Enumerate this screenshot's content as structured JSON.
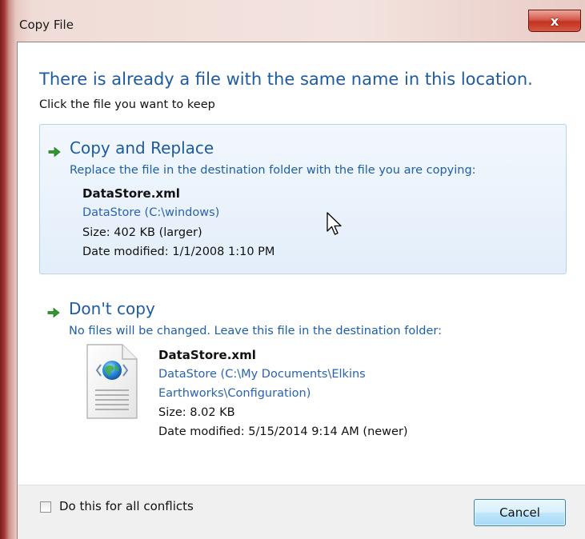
{
  "window": {
    "title": "Copy File",
    "close_label": "x"
  },
  "dialog": {
    "heading": "There is already a file with the same name in this location.",
    "subheading": "Click the file you want to keep"
  },
  "options": {
    "replace": {
      "title": "Copy and Replace",
      "description": "Replace the file in the destination folder with the file you are copying:",
      "file_name": "DataStore.xml",
      "file_path": "DataStore (C:\\windows)",
      "size": "Size: 402 KB (larger)",
      "date_modified": "Date modified: 1/1/2008 1:10 PM"
    },
    "dont_copy": {
      "title": "Don't copy",
      "description": "No files will be changed. Leave this file in the destination folder:",
      "file_name": "DataStore.xml",
      "file_path_line1": "DataStore (C:\\My Documents\\Elkins",
      "file_path_line2": "Earthworks\\Configuration)",
      "size": "Size: 8.02 KB",
      "date_modified": "Date modified: 5/15/2014 9:14 AM (newer)"
    }
  },
  "footer": {
    "checkbox_label": "Do this for all conflicts",
    "checkbox_checked": false,
    "cancel_label": "Cancel"
  },
  "icons": {
    "option_arrow": "green-arrow-right-icon",
    "file": "xml-document-globe-icon",
    "cursor": "mouse-pointer-icon"
  },
  "colors": {
    "heading": "#1d5b9e",
    "link_text": "#1e5fa6",
    "selected_option_bg": "#e8f1fb",
    "close_button": "#c23320",
    "arrow_green": "#2e9a2e"
  }
}
